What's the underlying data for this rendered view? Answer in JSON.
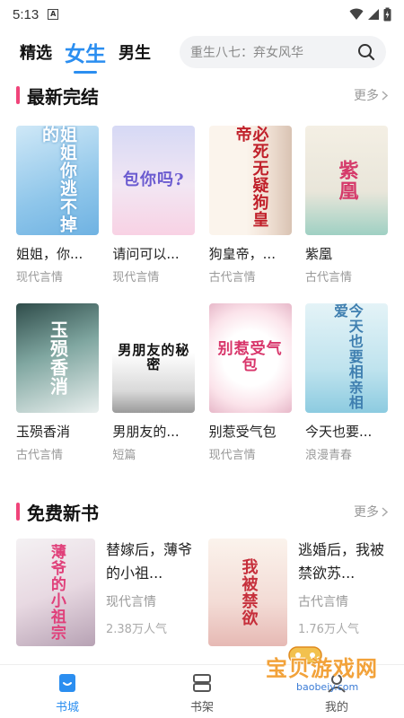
{
  "status": {
    "time": "5:13",
    "a_icon": "A"
  },
  "nav": {
    "tabs": [
      {
        "label": "精选"
      },
      {
        "label": "女生"
      },
      {
        "label": "男生"
      }
    ],
    "search_placeholder": "重生八七：弃女风华"
  },
  "sections": [
    {
      "title": "最新完结",
      "more": "更多"
    },
    {
      "title": "免费新书",
      "more": "更多"
    }
  ],
  "books_row1": [
    {
      "title": "姐姐，你...",
      "category": "现代言情",
      "cover_text": "姐姐你逃不掉的"
    },
    {
      "title": "请问可以...",
      "category": "现代言情",
      "cover_text": "包你吗?"
    },
    {
      "title": "狗皇帝，...",
      "category": "古代言情",
      "cover_text": "必死无疑狗皇帝"
    },
    {
      "title": "紫凰",
      "category": "古代言情",
      "cover_text": "紫凰"
    }
  ],
  "books_row2": [
    {
      "title": "玉殒香消",
      "category": "古代言情",
      "cover_text": "玉殒香消"
    },
    {
      "title": "男朋友的...",
      "category": "短篇",
      "cover_text": "男朋友的秘密"
    },
    {
      "title": "别惹受气包",
      "category": "现代言情",
      "cover_text": "别惹受气包"
    },
    {
      "title": "今天也要...",
      "category": "浪漫青春",
      "cover_text": "今天也要相亲相爱"
    }
  ],
  "free_books": [
    {
      "title": "替嫁后，薄爷的小祖...",
      "category": "现代言情",
      "popularity": "2.38万人气",
      "cover_text": "薄爷的小祖宗"
    },
    {
      "title": "逃婚后，我被禁欲苏...",
      "category": "古代言情",
      "popularity": "1.76万人气",
      "cover_text": "我被禁欲"
    }
  ],
  "tabbar": [
    {
      "label": "书城"
    },
    {
      "label": "书架"
    },
    {
      "label": "我的"
    }
  ],
  "watermark": {
    "text": "宝贝游戏网",
    "url": "baobeiy.com"
  },
  "colors": {
    "accent": "#2b8ef0",
    "section_bar": "#f0447a"
  }
}
